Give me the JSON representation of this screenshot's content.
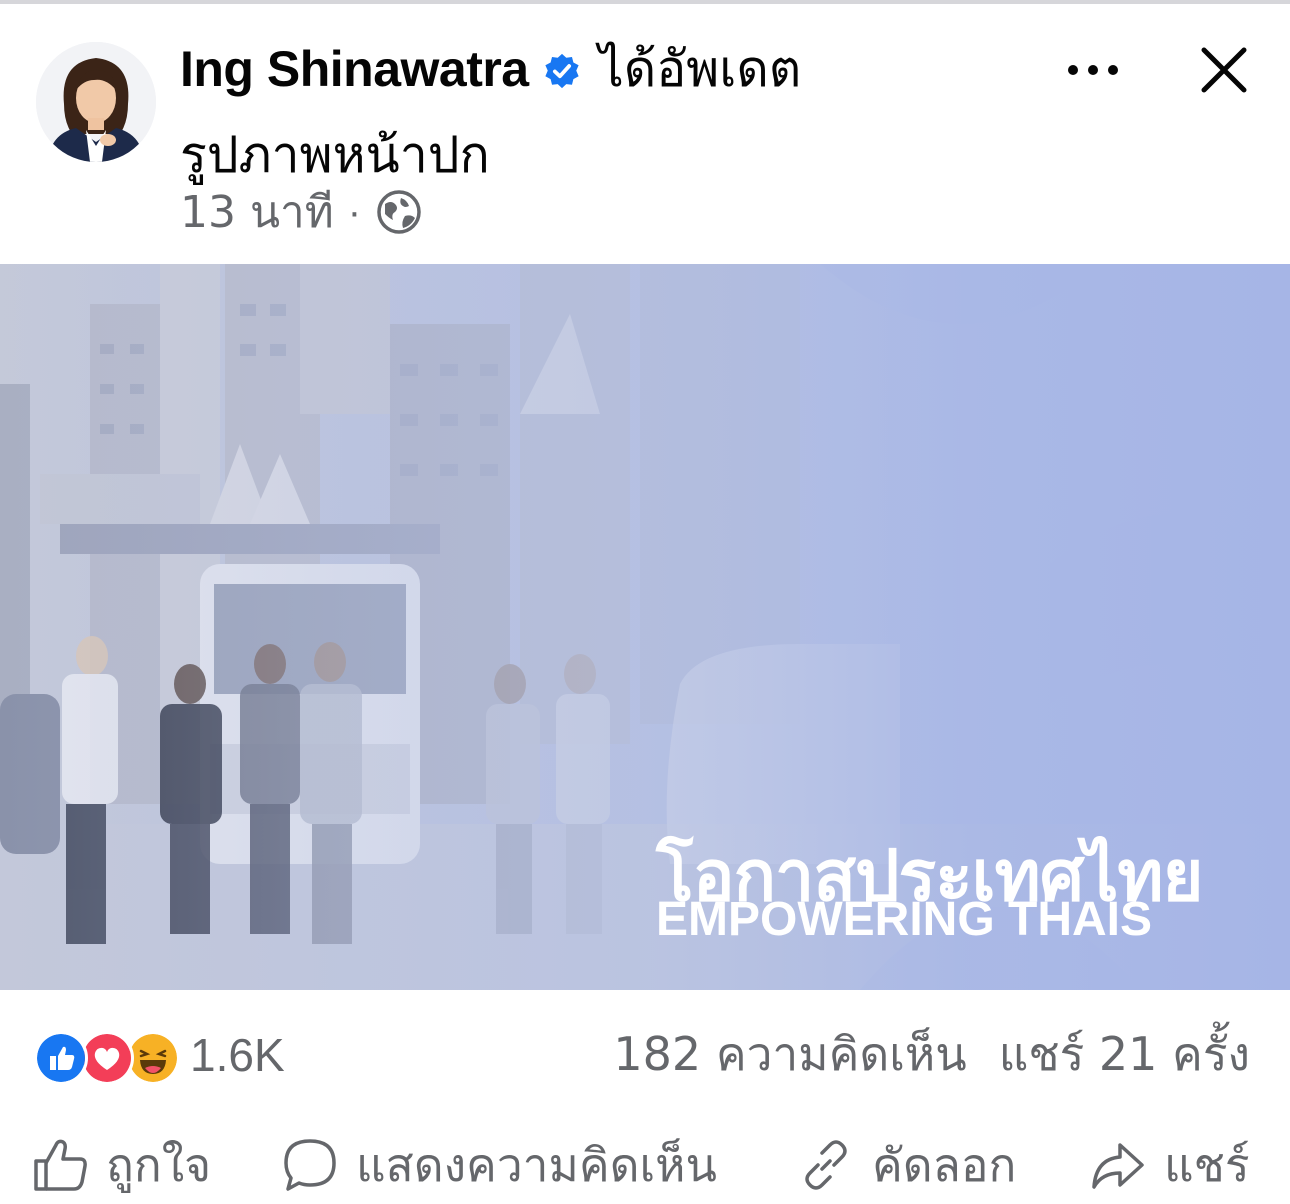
{
  "post": {
    "author_name": "Ing Shinawatra",
    "action_text": "ได้อัพเดต",
    "subtitle": "รูปภาพหน้าปก",
    "time": "13 นาที",
    "separator": "·"
  },
  "cover": {
    "title_thai": "โอกาสประเทศไทย",
    "title_english": "EMPOWERING THAIS"
  },
  "stats": {
    "reaction_count": "1.6K",
    "comments": "182 ความคิดเห็น",
    "shares": "แชร์ 21 ครั้ง"
  },
  "actions": {
    "like": "ถูกใจ",
    "comment": "แสดงความคิดเห็น",
    "copy": "คัดลอก",
    "share": "แชร์"
  },
  "colors": {
    "brand_blue": "#1877f2",
    "secondary_text": "#65676b",
    "love_red": "#f33e58",
    "haha_yellow": "#f7b125",
    "cover_tint": "#b3c0e6"
  },
  "icons": [
    "verified-badge-icon",
    "more-icon",
    "close-icon",
    "globe-icon",
    "like-reaction-icon",
    "love-reaction-icon",
    "haha-reaction-icon",
    "thumbs-up-icon",
    "comment-icon",
    "link-icon",
    "share-icon"
  ]
}
